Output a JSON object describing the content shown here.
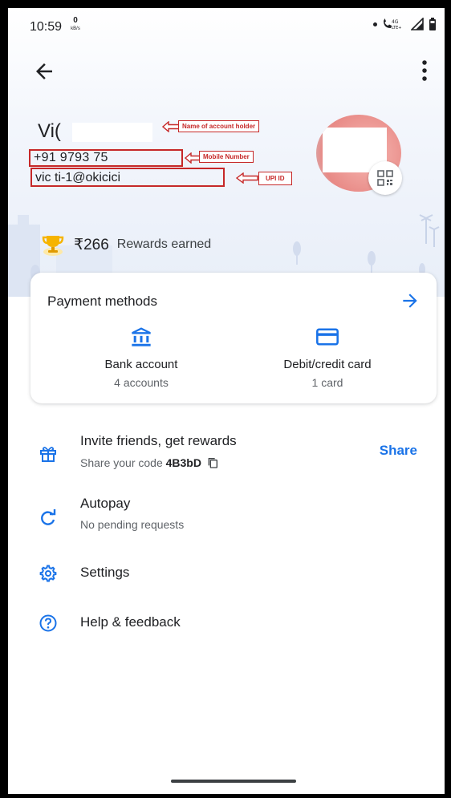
{
  "status_bar": {
    "time": "10:59",
    "speed_value": "0",
    "speed_unit": "kB/s",
    "network_label": "4G LTE+"
  },
  "profile": {
    "name": "Vi(",
    "phone": "+91 9793      75",
    "upi_id": "vic          ti-1@okicici"
  },
  "annotations": {
    "name_label": "Name of account holder",
    "mobile_label": "Mobile Number",
    "upi_label": "UPI ID"
  },
  "rewards": {
    "amount": "₹266",
    "label": "Rewards earned"
  },
  "payment_methods": {
    "title": "Payment methods",
    "items": [
      {
        "label": "Bank account",
        "sub": "4 accounts",
        "icon": "bank-icon"
      },
      {
        "label": "Debit/credit card",
        "sub": "1 card",
        "icon": "credit-card-icon"
      }
    ]
  },
  "menu": {
    "invite": {
      "title": "Invite friends, get rewards",
      "sub_prefix": "Share your code",
      "code": "4B3bD",
      "action": "Share",
      "icon": "gift-icon"
    },
    "autopay": {
      "title": "Autopay",
      "sub": "No pending requests",
      "icon": "autopay-icon"
    },
    "settings": {
      "title": "Settings",
      "icon": "gear-icon"
    },
    "help": {
      "title": "Help & feedback",
      "icon": "help-icon"
    }
  },
  "colors": {
    "accent": "#1a73e8",
    "annotation_red": "#c62828",
    "reward_gold": "#f6b400"
  }
}
